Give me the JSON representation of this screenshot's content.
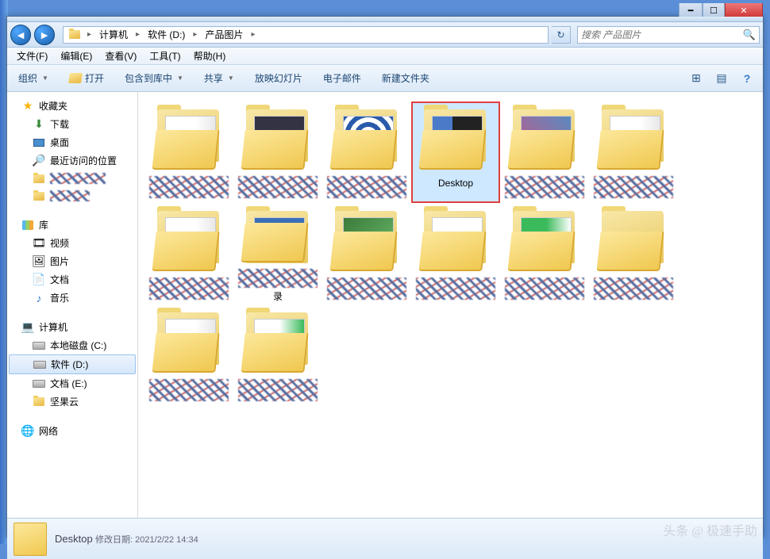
{
  "breadcrumb": {
    "segments": [
      "计算机",
      "软件 (D:)",
      "产品图片"
    ]
  },
  "search": {
    "placeholder": "搜索 产品图片"
  },
  "menubar": {
    "items": [
      "文件(F)",
      "编辑(E)",
      "查看(V)",
      "工具(T)",
      "帮助(H)"
    ]
  },
  "toolbar": {
    "organize": "组织",
    "open": "打开",
    "include": "包含到库中",
    "share": "共享",
    "slideshow": "放映幻灯片",
    "email": "电子邮件",
    "newfolder": "新建文件夹"
  },
  "sidebar": {
    "favorites": {
      "label": "收藏夹",
      "items": [
        "下载",
        "桌面",
        "最近访问的位置"
      ]
    },
    "libraries": {
      "label": "库",
      "items": [
        "视频",
        "图片",
        "文档",
        "音乐"
      ]
    },
    "computer": {
      "label": "计算机",
      "items": [
        "本地磁盘 (C:)",
        "软件 (D:)",
        "文档 (E:)",
        "坚果云"
      ]
    },
    "network": {
      "label": "网络"
    }
  },
  "content": {
    "selected_folder": "Desktop",
    "row2_label": "录"
  },
  "statusbar": {
    "name": "Desktop",
    "meta_label": "修改日期:",
    "meta_value": "2021/2/22 14:34"
  }
}
